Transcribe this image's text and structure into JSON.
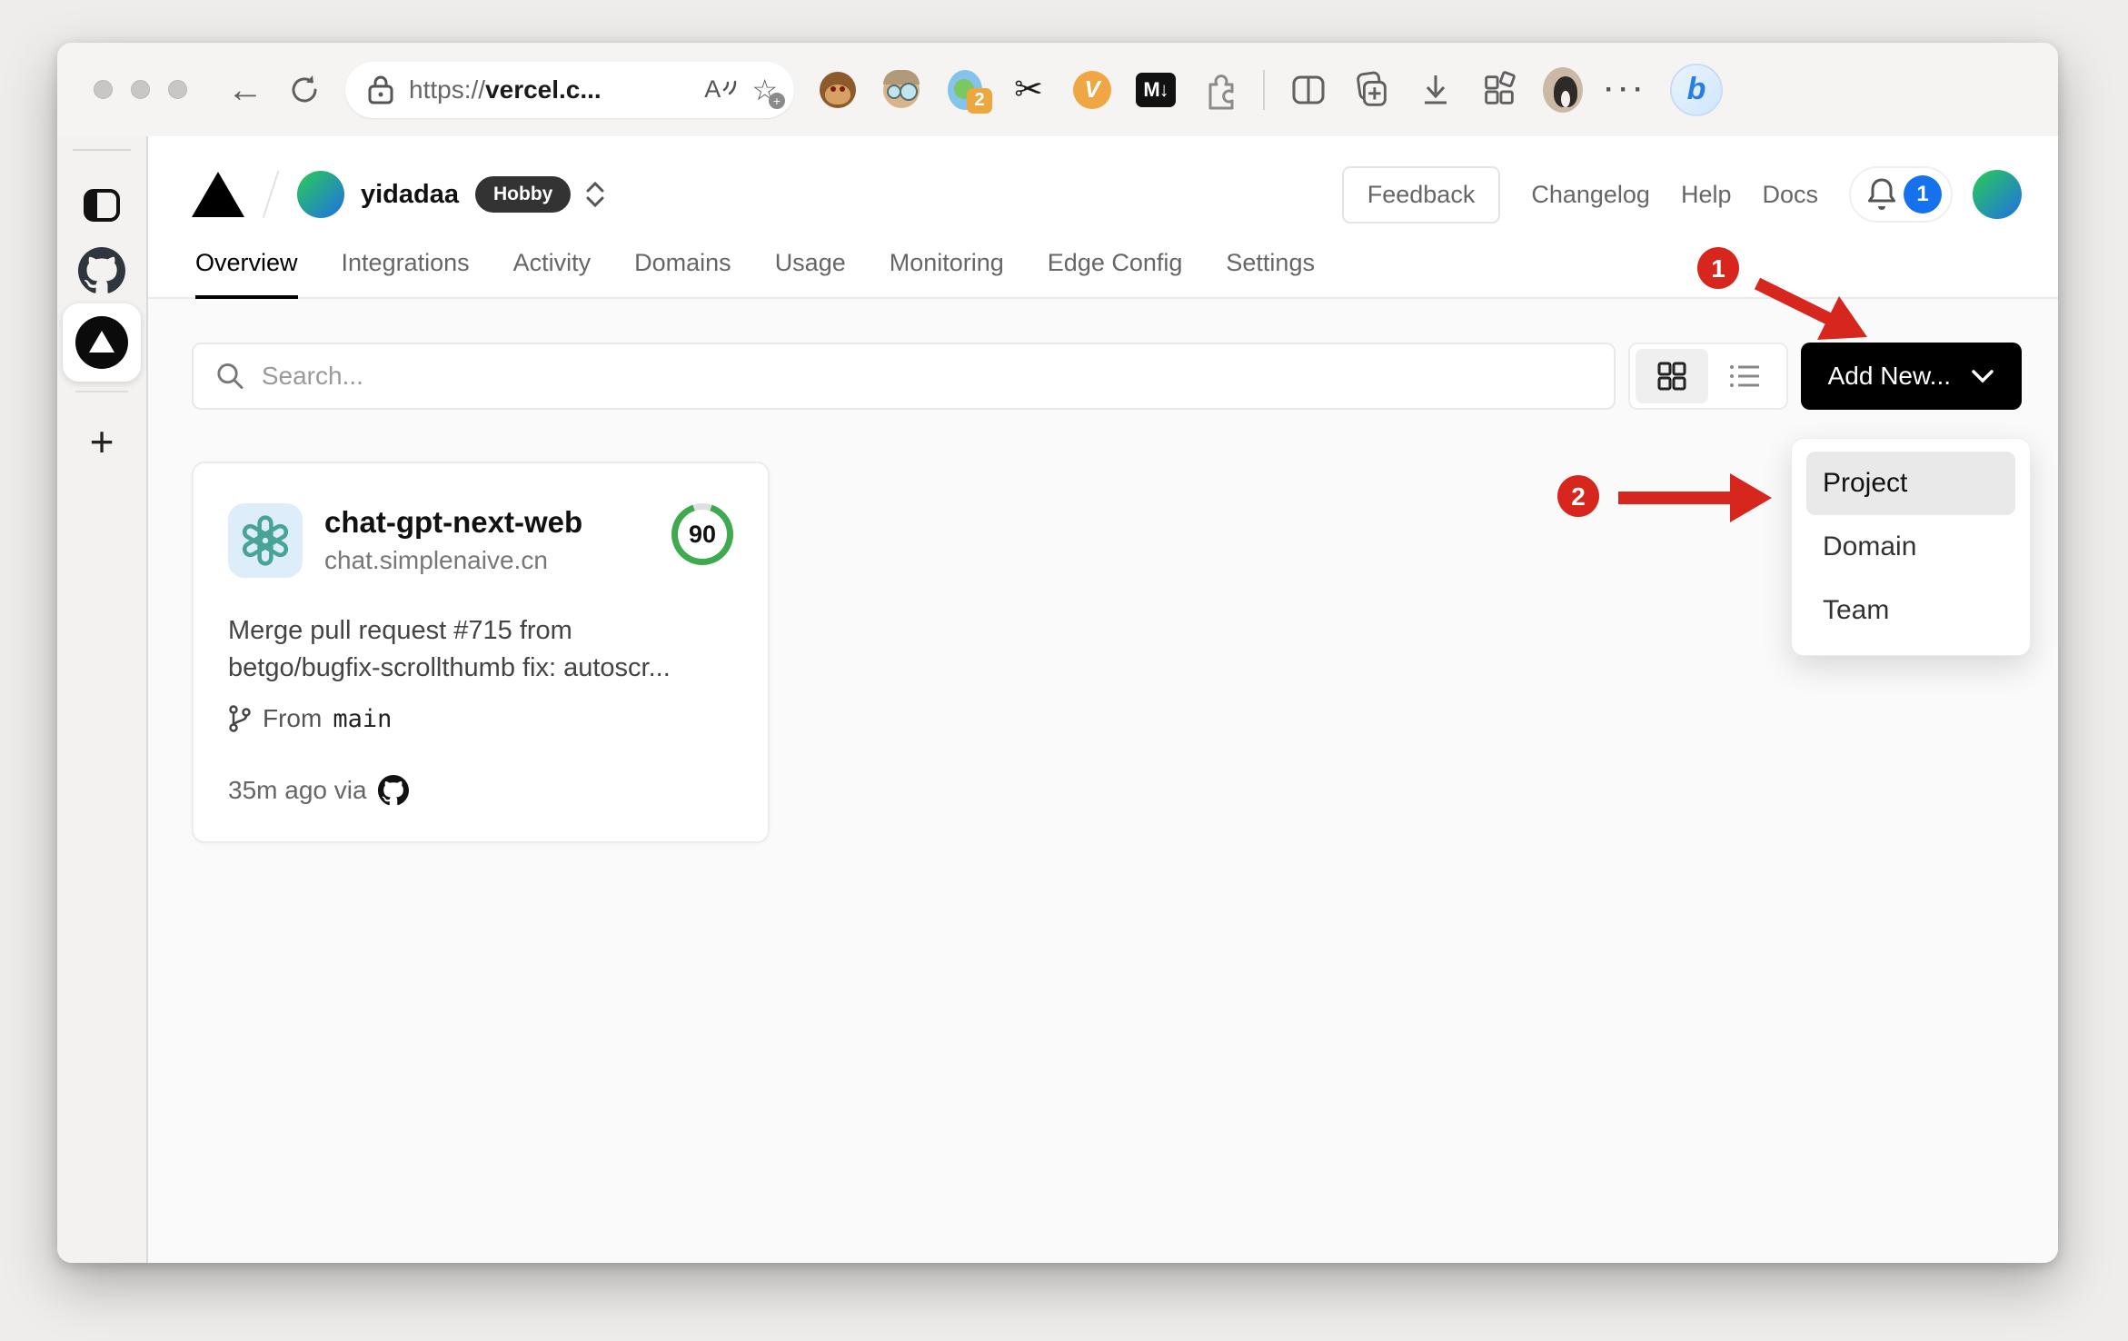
{
  "browser": {
    "url_scheme": "https://",
    "url_host": "vercel.c...",
    "read_aloud_label": "A",
    "extensions_badge": "2",
    "vimium_badge": "V",
    "markdown_badge": "M↓",
    "more_dots": "···",
    "bing_label": "b"
  },
  "header": {
    "team_name": "yidadaa",
    "plan_badge": "Hobby",
    "feedback_label": "Feedback",
    "changelog_label": "Changelog",
    "help_label": "Help",
    "docs_label": "Docs",
    "notification_count": "1"
  },
  "tabs": [
    {
      "label": "Overview",
      "active": true
    },
    {
      "label": "Integrations",
      "active": false
    },
    {
      "label": "Activity",
      "active": false
    },
    {
      "label": "Domains",
      "active": false
    },
    {
      "label": "Usage",
      "active": false
    },
    {
      "label": "Monitoring",
      "active": false
    },
    {
      "label": "Edge Config",
      "active": false
    },
    {
      "label": "Settings",
      "active": false
    }
  ],
  "toolbar": {
    "search_placeholder": "Search...",
    "add_new_label": "Add New..."
  },
  "project_card": {
    "name": "chat-gpt-next-web",
    "domain": "chat.simplenaive.cn",
    "score": "90",
    "commit_line1": "Merge pull request #715 from",
    "commit_line2": "betgo/bugfix-scrollthumb fix: autoscr...",
    "branch_prefix": "From",
    "branch_name": "main",
    "deployed_time": "35m ago via"
  },
  "dropdown": {
    "items": [
      {
        "label": "Project",
        "active": true
      },
      {
        "label": "Domain",
        "active": false
      },
      {
        "label": "Team",
        "active": false
      }
    ]
  },
  "annotations": {
    "step1": "1",
    "step2": "2",
    "color": "#d7261d"
  },
  "colors": {
    "accent_green": "#3fa94f",
    "badge_blue": "#1672ec",
    "button_black": "#000000",
    "page_bg": "#fafafa"
  }
}
